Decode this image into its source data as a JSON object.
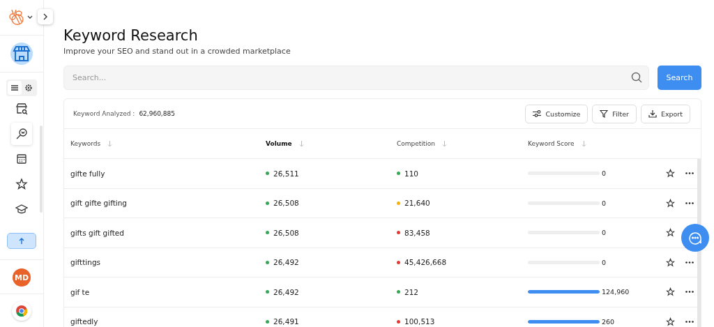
{
  "sidebar": {
    "view_toggle": [
      {
        "kind": "list",
        "selected": true
      },
      {
        "kind": "gear",
        "selected": false
      }
    ],
    "nav": [
      {
        "kind": "store-search",
        "selected": false
      },
      {
        "kind": "magnifier",
        "selected": true
      },
      {
        "kind": "calendar",
        "selected": false
      },
      {
        "kind": "star",
        "selected": false
      },
      {
        "kind": "cap",
        "selected": false
      }
    ],
    "avatar": "MD"
  },
  "header": {
    "title": "Keyword Research",
    "subtitle": "Improve your SEO and stand out in a crowded marketplace"
  },
  "search": {
    "placeholder": "Search...",
    "button": "Search"
  },
  "summary": {
    "label": "Keyword Analyzed :",
    "value": "62,960,885"
  },
  "actions": [
    {
      "kind": "customize",
      "label": "Customize"
    },
    {
      "kind": "filter",
      "label": "Filter"
    },
    {
      "kind": "export",
      "label": "Export"
    }
  ],
  "table": {
    "columns": [
      {
        "label": "Keywords",
        "bold": false
      },
      {
        "label": "Volume",
        "bold": true
      },
      {
        "label": "Competition",
        "bold": false
      },
      {
        "label": "Keyword Score",
        "bold": false
      }
    ],
    "rows": [
      {
        "keyword": "gifte fully",
        "volume": {
          "text": "26,511",
          "color": "#34a853"
        },
        "competition": {
          "text": "110",
          "color": "#34a853"
        },
        "level": 0,
        "score": "0"
      },
      {
        "keyword": "gift gifte gifting",
        "volume": {
          "text": "26,508",
          "color": "#34a853"
        },
        "competition": {
          "text": "21,640",
          "color": "#f4b400"
        },
        "level": 0,
        "score": "0"
      },
      {
        "keyword": "gifts gift gifted",
        "volume": {
          "text": "26,508",
          "color": "#34a853"
        },
        "competition": {
          "text": "83,458",
          "color": "#e53935"
        },
        "level": 0,
        "score": "0"
      },
      {
        "keyword": "gifttings",
        "volume": {
          "text": "26,492",
          "color": "#34a853"
        },
        "competition": {
          "text": "45,426,668",
          "color": "#e53935"
        },
        "level": 0,
        "score": "0"
      },
      {
        "keyword": "gif te",
        "volume": {
          "text": "26,492",
          "color": "#34a853"
        },
        "competition": {
          "text": "212",
          "color": "#34a853"
        },
        "level": 1,
        "score": "124,960"
      },
      {
        "keyword": "giftedly",
        "volume": {
          "text": "26,491",
          "color": "#34a853"
        },
        "competition": {
          "text": "100,513",
          "color": "#e53935"
        },
        "level": 1,
        "score": "260"
      }
    ]
  }
}
